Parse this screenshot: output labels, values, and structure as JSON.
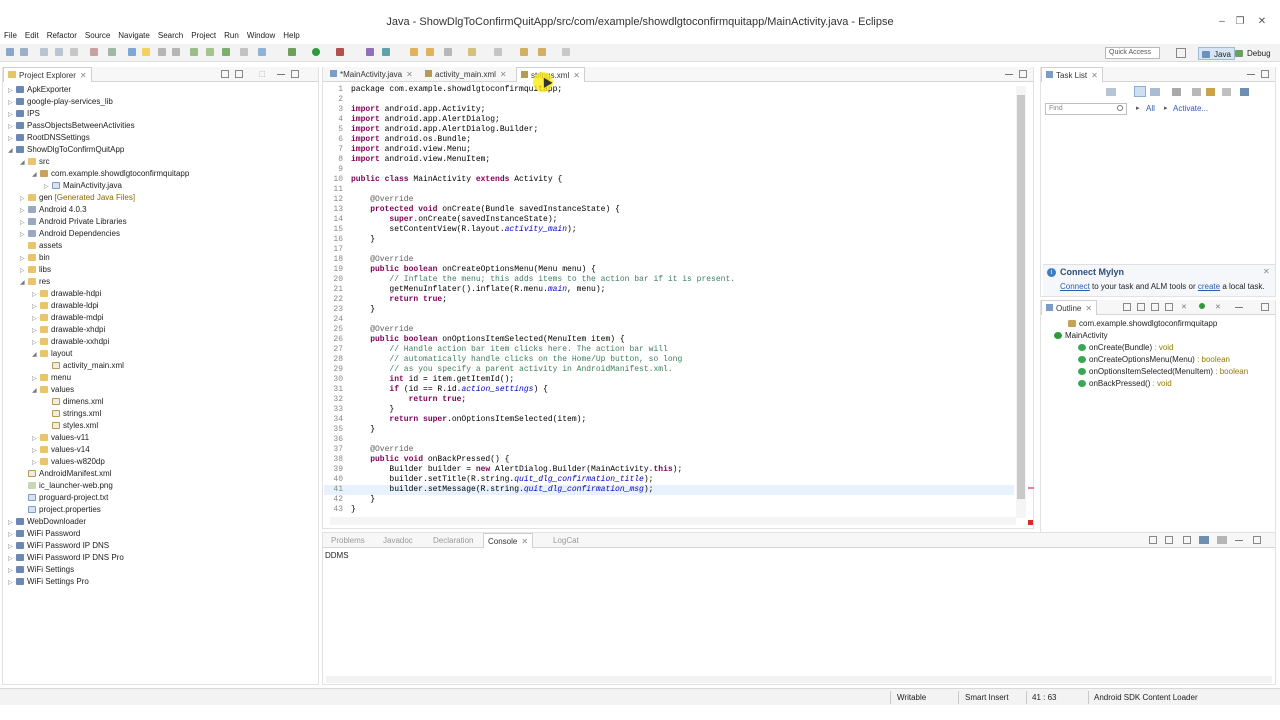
{
  "window": {
    "title": "Java - ShowDlgToConfirmQuitApp/src/com/example/showdlgtoconfirmquitapp/MainActivity.java - Eclipse",
    "controls": {
      "minimize": "–",
      "maximize": "❐",
      "close": "✕"
    }
  },
  "menu": [
    "File",
    "Edit",
    "Refactor",
    "Source",
    "Navigate",
    "Search",
    "Project",
    "Run",
    "Window",
    "Help"
  ],
  "toolbar": {
    "quick_access": "Quick Access",
    "perspectives": [
      {
        "label": "Java"
      },
      {
        "label": "Debug"
      }
    ]
  },
  "project_explorer": {
    "tab": "Project Explorer",
    "tree": [
      {
        "depth": 0,
        "arrow": "▷",
        "icon": "proj",
        "label": "ApkExporter"
      },
      {
        "depth": 0,
        "arrow": "▷",
        "icon": "proj",
        "label": "google-play-services_lib"
      },
      {
        "depth": 0,
        "arrow": "▷",
        "icon": "proj",
        "label": "IPS"
      },
      {
        "depth": 0,
        "arrow": "▷",
        "icon": "proj",
        "label": "PassObjectsBetweenActivities"
      },
      {
        "depth": 0,
        "arrow": "▷",
        "icon": "proj",
        "label": "RootDNSSettings"
      },
      {
        "depth": 0,
        "arrow": "◢",
        "icon": "proj",
        "label": "ShowDlgToConfirmQuitApp"
      },
      {
        "depth": 1,
        "arrow": "◢",
        "icon": "fold",
        "label": "src"
      },
      {
        "depth": 2,
        "arrow": "◢",
        "icon": "pkg",
        "label": "com.example.showdlgtoconfirmquitapp"
      },
      {
        "depth": 3,
        "arrow": "▷",
        "icon": "jfile",
        "label": "MainActivity.java"
      },
      {
        "depth": 1,
        "arrow": "▷",
        "icon": "fold",
        "label": "gen",
        "deco": "[Generated Java Files]"
      },
      {
        "depth": 1,
        "arrow": "▷",
        "icon": "lib",
        "label": "Android 4.0.3"
      },
      {
        "depth": 1,
        "arrow": "▷",
        "icon": "lib",
        "label": "Android Private Libraries"
      },
      {
        "depth": 1,
        "arrow": "▷",
        "icon": "lib",
        "label": "Android Dependencies"
      },
      {
        "depth": 1,
        "arrow": "",
        "icon": "fold",
        "label": "assets"
      },
      {
        "depth": 1,
        "arrow": "▷",
        "icon": "fold",
        "label": "bin"
      },
      {
        "depth": 1,
        "arrow": "▷",
        "icon": "fold",
        "label": "libs"
      },
      {
        "depth": 1,
        "arrow": "◢",
        "icon": "fold",
        "label": "res"
      },
      {
        "depth": 2,
        "arrow": "▷",
        "icon": "fold",
        "label": "drawable-hdpi"
      },
      {
        "depth": 2,
        "arrow": "▷",
        "icon": "fold",
        "label": "drawable-ldpi"
      },
      {
        "depth": 2,
        "arrow": "▷",
        "icon": "fold",
        "label": "drawable-mdpi"
      },
      {
        "depth": 2,
        "arrow": "▷",
        "icon": "fold",
        "label": "drawable-xhdpi"
      },
      {
        "depth": 2,
        "arrow": "▷",
        "icon": "fold",
        "label": "drawable-xxhdpi"
      },
      {
        "depth": 2,
        "arrow": "◢",
        "icon": "fold",
        "label": "layout"
      },
      {
        "depth": 3,
        "arrow": "",
        "icon": "xfile",
        "label": "activity_main.xml"
      },
      {
        "depth": 2,
        "arrow": "▷",
        "icon": "fold",
        "label": "menu"
      },
      {
        "depth": 2,
        "arrow": "◢",
        "icon": "fold",
        "label": "values"
      },
      {
        "depth": 3,
        "arrow": "",
        "icon": "xfile",
        "label": "dimens.xml"
      },
      {
        "depth": 3,
        "arrow": "",
        "icon": "xfile",
        "label": "strings.xml"
      },
      {
        "depth": 3,
        "arrow": "",
        "icon": "xfile",
        "label": "styles.xml"
      },
      {
        "depth": 2,
        "arrow": "▷",
        "icon": "fold",
        "label": "values-v11"
      },
      {
        "depth": 2,
        "arrow": "▷",
        "icon": "fold",
        "label": "values-v14"
      },
      {
        "depth": 2,
        "arrow": "▷",
        "icon": "fold",
        "label": "values-w820dp"
      },
      {
        "depth": 1,
        "arrow": "",
        "icon": "xfile",
        "label": "AndroidManifest.xml"
      },
      {
        "depth": 1,
        "arrow": "",
        "icon": "img",
        "label": "ic_launcher-web.png"
      },
      {
        "depth": 1,
        "arrow": "",
        "icon": "jfile",
        "label": "proguard-project.txt"
      },
      {
        "depth": 1,
        "arrow": "",
        "icon": "jfile",
        "label": "project.properties"
      },
      {
        "depth": 0,
        "arrow": "▷",
        "icon": "proj",
        "label": "WebDownloader"
      },
      {
        "depth": 0,
        "arrow": "▷",
        "icon": "proj",
        "label": "WiFi Password"
      },
      {
        "depth": 0,
        "arrow": "▷",
        "icon": "proj",
        "label": "WiFi Password IP DNS"
      },
      {
        "depth": 0,
        "arrow": "▷",
        "icon": "proj",
        "label": "WiFi Password IP DNS Pro"
      },
      {
        "depth": 0,
        "arrow": "▷",
        "icon": "proj",
        "label": "WiFi Settings"
      },
      {
        "depth": 0,
        "arrow": "▷",
        "icon": "proj",
        "label": "WiFi Settings Pro"
      }
    ]
  },
  "editor": {
    "tabs": [
      {
        "label": "*MainActivity.java",
        "active": false
      },
      {
        "label": "activity_main.xml",
        "active": false
      },
      {
        "label": "strings.xml",
        "active": true
      }
    ],
    "highlight_line": 41,
    "lines": [
      [
        [
          null,
          "package com.example.showdlgtoconfirmquitapp;"
        ]
      ],
      [],
      [
        [
          "kw",
          "import"
        ],
        [
          null,
          " android.app.Activity;"
        ]
      ],
      [
        [
          "kw",
          "import"
        ],
        [
          null,
          " android.app.AlertDialog;"
        ]
      ],
      [
        [
          "kw",
          "import"
        ],
        [
          null,
          " android.app.AlertDialog.Builder;"
        ]
      ],
      [
        [
          "kw",
          "import"
        ],
        [
          null,
          " android.os.Bundle;"
        ]
      ],
      [
        [
          "kw",
          "import"
        ],
        [
          null,
          " android.view.Menu;"
        ]
      ],
      [
        [
          "kw",
          "import"
        ],
        [
          null,
          " android.view.MenuItem;"
        ]
      ],
      [],
      [
        [
          "kw",
          "public class"
        ],
        [
          null,
          " MainActivity "
        ],
        [
          "kw",
          "extends"
        ],
        [
          null,
          " Activity {"
        ]
      ],
      [],
      [
        [
          null,
          "    "
        ],
        [
          "an",
          "@Override"
        ]
      ],
      [
        [
          null,
          "    "
        ],
        [
          "kw",
          "protected void"
        ],
        [
          null,
          " onCreate(Bundle savedInstanceState) {"
        ]
      ],
      [
        [
          null,
          "        "
        ],
        [
          "kw",
          "super"
        ],
        [
          null,
          ".onCreate(savedInstanceState);"
        ]
      ],
      [
        [
          null,
          "        setContentView(R.layout."
        ],
        [
          "it",
          "activity_main"
        ],
        [
          null,
          ");"
        ]
      ],
      [
        [
          null,
          "    }"
        ]
      ],
      [],
      [
        [
          null,
          "    "
        ],
        [
          "an",
          "@Override"
        ]
      ],
      [
        [
          null,
          "    "
        ],
        [
          "kw",
          "public boolean"
        ],
        [
          null,
          " onCreateOptionsMenu(Menu menu) {"
        ]
      ],
      [
        [
          null,
          "        "
        ],
        [
          "cm",
          "// Inflate the menu; this adds items to the action bar if it is present."
        ]
      ],
      [
        [
          null,
          "        getMenuInflater().inflate(R.menu."
        ],
        [
          "it",
          "main"
        ],
        [
          null,
          ", menu);"
        ]
      ],
      [
        [
          null,
          "        "
        ],
        [
          "kw",
          "return true"
        ],
        [
          null,
          ";"
        ]
      ],
      [
        [
          null,
          "    }"
        ]
      ],
      [],
      [
        [
          null,
          "    "
        ],
        [
          "an",
          "@Override"
        ]
      ],
      [
        [
          null,
          "    "
        ],
        [
          "kw",
          "public boolean"
        ],
        [
          null,
          " onOptionsItemSelected(MenuItem item) {"
        ]
      ],
      [
        [
          null,
          "        "
        ],
        [
          "cm",
          "// Handle action bar item clicks here. The action bar will"
        ]
      ],
      [
        [
          null,
          "        "
        ],
        [
          "cm",
          "// automatically handle clicks on the Home/Up button, so long"
        ]
      ],
      [
        [
          null,
          "        "
        ],
        [
          "cm",
          "// as you specify a parent activity in AndroidManifest.xml."
        ]
      ],
      [
        [
          null,
          "        "
        ],
        [
          "kw",
          "int"
        ],
        [
          null,
          " id = item.getItemId();"
        ]
      ],
      [
        [
          null,
          "        "
        ],
        [
          "kw",
          "if"
        ],
        [
          null,
          " (id == R.id."
        ],
        [
          "it",
          "action_settings"
        ],
        [
          null,
          ") {"
        ]
      ],
      [
        [
          null,
          "            "
        ],
        [
          "kw",
          "return true"
        ],
        [
          null,
          ";"
        ]
      ],
      [
        [
          null,
          "        }"
        ]
      ],
      [
        [
          null,
          "        "
        ],
        [
          "kw",
          "return super"
        ],
        [
          null,
          ".onOptionsItemSelected(item);"
        ]
      ],
      [
        [
          null,
          "    }"
        ]
      ],
      [],
      [
        [
          null,
          "    "
        ],
        [
          "an",
          "@Override"
        ]
      ],
      [
        [
          null,
          "    "
        ],
        [
          "kw",
          "public void"
        ],
        [
          null,
          " onBackPressed() {"
        ]
      ],
      [
        [
          null,
          "        Builder builder = "
        ],
        [
          "kw",
          "new"
        ],
        [
          null,
          " AlertDialog.Builder(MainActivity."
        ],
        [
          "kw",
          "this"
        ],
        [
          null,
          ");"
        ]
      ],
      [
        [
          null,
          "        builder.setTitle(R.string."
        ],
        [
          "it",
          "quit_dlg_confirmation_title"
        ],
        [
          null,
          ");"
        ]
      ],
      [
        [
          null,
          "        builder.setMessage(R.string."
        ],
        [
          "it",
          "quit_dlg_confirmation_msg"
        ],
        [
          null,
          ");"
        ]
      ],
      [
        [
          null,
          "    }"
        ]
      ],
      [
        [
          null,
          "}"
        ]
      ]
    ]
  },
  "task_list": {
    "tab": "Task List",
    "find_placeholder": "Find",
    "all": "All",
    "activate": "Activate...",
    "mylyn_title": "Connect Mylyn",
    "mylyn_connect": "Connect",
    "mylyn_mid": " to your task and ALM tools or ",
    "mylyn_create": "create",
    "mylyn_end": " a local task."
  },
  "outline": {
    "tab": "Outline",
    "items": [
      {
        "label": "com.example.showdlgtoconfirmquitapp",
        "type": ""
      },
      {
        "label": "MainActivity",
        "type": ""
      },
      {
        "label": "onCreate(Bundle)",
        "type": " : void"
      },
      {
        "label": "onCreateOptionsMenu(Menu)",
        "type": " : boolean"
      },
      {
        "label": "onOptionsItemSelected(MenuItem)",
        "type": " : boolean"
      },
      {
        "label": "onBackPressed()",
        "type": " : void"
      }
    ]
  },
  "bottom": {
    "tabs": [
      "Problems",
      "Javadoc",
      "Declaration",
      "Console",
      "LogCat"
    ],
    "active_tab": "Console",
    "console_text": "DDMS"
  },
  "status": {
    "writable": "Writable",
    "insert": "Smart Insert",
    "position": "41 : 63",
    "loader": "Android SDK Content Loader"
  },
  "colors": {
    "keyword": "#7f0055",
    "comment": "#3f7f5f",
    "annotation": "#646464",
    "field": "#0000c0",
    "accent": "#2a5db0"
  }
}
